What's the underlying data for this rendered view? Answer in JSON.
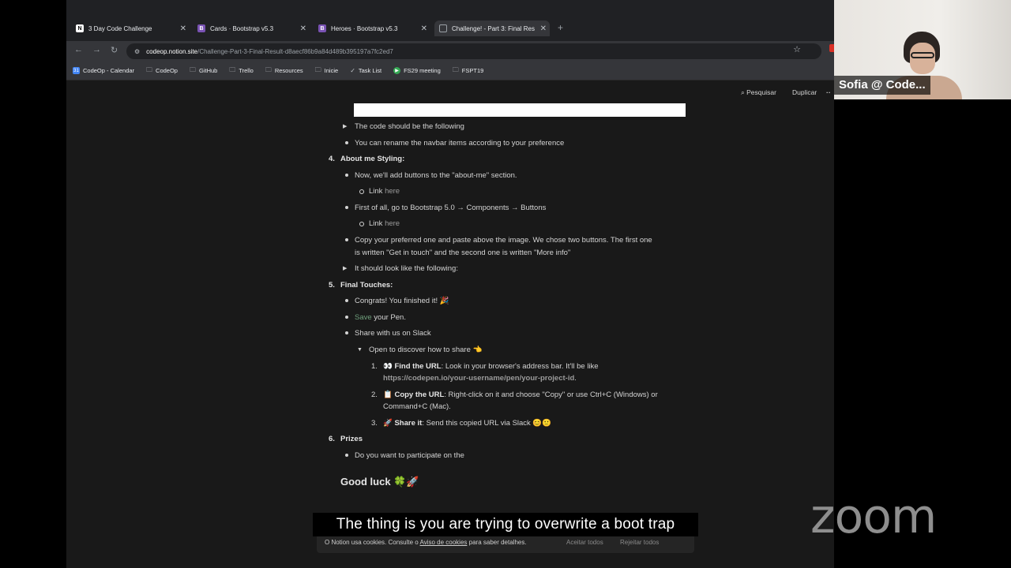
{
  "tabs": [
    {
      "title": "3 Day Code Challenge",
      "icon": "notion-icon",
      "favicon_text": ""
    },
    {
      "title": "Cards · Bootstrap v5.3",
      "icon": "bootstrap-icon",
      "favicon_text": "B"
    },
    {
      "title": "Heroes · Bootstrap v5.3",
      "icon": "bootstrap-icon",
      "favicon_text": "B"
    },
    {
      "title": "Challenge! - Part 3: Final Res",
      "icon": "page-icon",
      "favicon_text": ""
    }
  ],
  "address_bar": {
    "host": "codeop.notion.site",
    "path": "/Challenge-Part-3-Final-Result-d8aecf86b9a84d489b395197a7fc2ed7"
  },
  "bookmarks": [
    {
      "label": "CodeOp - Calendar",
      "icon": "calendar-icon"
    },
    {
      "label": "CodeOp",
      "icon": "folder-icon"
    },
    {
      "label": "GitHub",
      "icon": "folder-icon"
    },
    {
      "label": "Trello",
      "icon": "folder-icon"
    },
    {
      "label": "Resources",
      "icon": "folder-icon"
    },
    {
      "label": "Inicie",
      "icon": "folder-icon"
    },
    {
      "label": "Task List",
      "icon": "check-icon"
    },
    {
      "label": "FS29 meeting",
      "icon": "meet-icon"
    },
    {
      "label": "FSPT19",
      "icon": "folder-icon"
    }
  ],
  "notion_topbar": {
    "search": "Pesquisar",
    "duplicate": "Duplicar",
    "more": "··"
  },
  "content": {
    "toggle_code": "The code should be the following",
    "rename_navbar": "You can rename the navbar items according to your preference",
    "step4_num": "4.",
    "step4_title": "About me Styling:",
    "add_buttons": "Now, we'll add buttons to the \"about-me\" section.",
    "link_label": "Link ",
    "here": "here",
    "bootstrap_path": "First of all, go to Bootstrap 5.0 → Components → Buttons",
    "copy_preferred_1": "Copy your preferred one and paste above the image. We chose two buttons. The first one",
    "copy_preferred_2": "is written \"Get in touch\" and the second one is written \"More info\"",
    "toggle_look": "It should look like the following:",
    "step5_num": "5.",
    "step5_title": "Final Touches:",
    "congrats": "Congrats! You finished it! 🎉",
    "save": "Save",
    "your_pen": " your Pen.",
    "share_slack": "Share with us on Slack",
    "toggle_share": "Open to discover how to share 👈",
    "sub1_num": "1.",
    "sub1_title": "👀 Find the URL",
    "sub1_text": ": Look in your browser's address bar. It'll be like",
    "sub1_url": "https://codepen.io/your-username/pen/your-project-id",
    "sub1_end": ".",
    "sub2_num": "2.",
    "sub2_title": "📋 Copy the URL",
    "sub2_text": ": Right-click on it and choose \"Copy\" or use Ctrl+C (Windows) or",
    "sub2_text2": "Command+C (Mac).",
    "sub3_num": "3.",
    "sub3_title": "🚀 Share it",
    "sub3_text": ": Send this copied URL via Slack 😊🙂",
    "step6_num": "6.",
    "step6_title": "Prizes",
    "participate": "Do you want to participate on the",
    "good_luck": "Good luck 🍀🚀"
  },
  "cookie_banner": {
    "text": "O Notion usa cookies. Consulte o ",
    "link": "Aviso de cookies",
    "text_end": " para saber detalhes.",
    "accept": "Aceitar todos",
    "reject": "Rejeitar todos"
  },
  "caption": "The thing is you are trying to overwrite a boot trap",
  "zoom_logo": "zoom",
  "webcam": {
    "name": "Sofia @ Code..."
  }
}
